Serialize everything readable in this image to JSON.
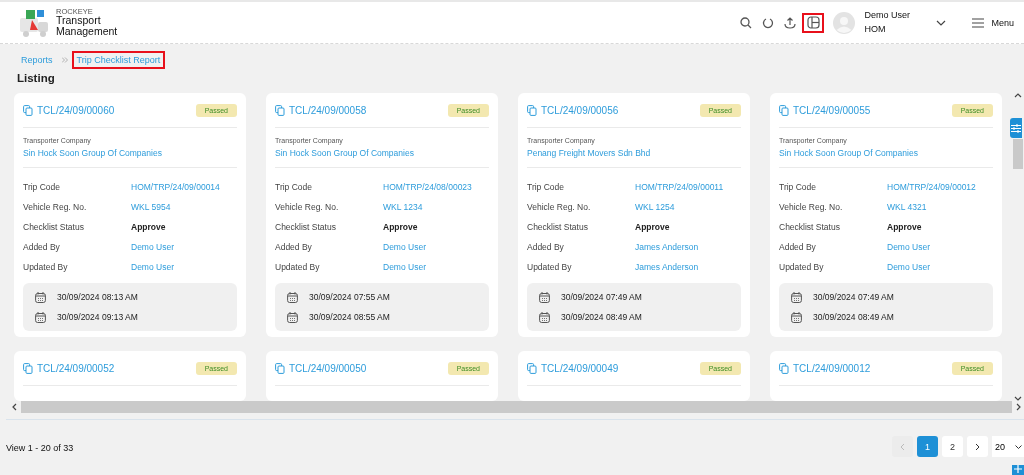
{
  "header": {
    "brand_small": "ROCKEYE",
    "brand_line_1": "Transport",
    "brand_line_2": "Management",
    "user_name": "Demo User",
    "user_org": "HOM",
    "menu_label": "Menu",
    "layout_icon_highlighted": true
  },
  "breadcrumb": [
    {
      "label": "Reports",
      "highlighted": false
    },
    {
      "label": "Trip Checklist Report",
      "highlighted": true
    }
  ],
  "page_title": "Listing",
  "cards": [
    {
      "code": "TCL/24/09/00060",
      "status": "Passed",
      "company_label": "Transporter Company",
      "company": "Sin Hock Soon Group Of Companies",
      "details": [
        {
          "label": "Trip Code",
          "value": "HOM/TRP/24/09/00014",
          "kind": "link"
        },
        {
          "label": "Vehicle Reg. No.",
          "value": "WKL 5954",
          "kind": "link"
        },
        {
          "label": "Checklist Status",
          "value": "Approve",
          "kind": "text"
        },
        {
          "label": "Added By",
          "value": "Demo User",
          "kind": "link"
        },
        {
          "label": "Updated By",
          "value": "Demo User",
          "kind": "link"
        }
      ],
      "dates": [
        "30/09/2024 08:13 AM",
        "30/09/2024 09:13 AM"
      ]
    },
    {
      "code": "TCL/24/09/00058",
      "status": "Passed",
      "company_label": "Transporter Company",
      "company": "Sin Hock Soon Group Of Companies",
      "details": [
        {
          "label": "Trip Code",
          "value": "HOM/TRP/24/08/00023",
          "kind": "link"
        },
        {
          "label": "Vehicle Reg. No.",
          "value": "WKL 1234",
          "kind": "link"
        },
        {
          "label": "Checklist Status",
          "value": "Approve",
          "kind": "text"
        },
        {
          "label": "Added By",
          "value": "Demo User",
          "kind": "link"
        },
        {
          "label": "Updated By",
          "value": "Demo User",
          "kind": "link"
        }
      ],
      "dates": [
        "30/09/2024 07:55 AM",
        "30/09/2024 08:55 AM"
      ]
    },
    {
      "code": "TCL/24/09/00056",
      "status": "Passed",
      "company_label": "Transporter Company",
      "company": "Penang Freight Movers Sdn Bhd",
      "details": [
        {
          "label": "Trip Code",
          "value": "HOM/TRP/24/09/00011",
          "kind": "link"
        },
        {
          "label": "Vehicle Reg. No.",
          "value": "WKL 1254",
          "kind": "link"
        },
        {
          "label": "Checklist Status",
          "value": "Approve",
          "kind": "text"
        },
        {
          "label": "Added By",
          "value": "James Anderson",
          "kind": "link"
        },
        {
          "label": "Updated By",
          "value": "James Anderson",
          "kind": "link"
        }
      ],
      "dates": [
        "30/09/2024 07:49 AM",
        "30/09/2024 08:49 AM"
      ]
    },
    {
      "code": "TCL/24/09/00055",
      "status": "Passed",
      "company_label": "Transporter Company",
      "company": "Sin Hock Soon Group Of Companies",
      "details": [
        {
          "label": "Trip Code",
          "value": "HOM/TRP/24/09/00012",
          "kind": "link"
        },
        {
          "label": "Vehicle Reg. No.",
          "value": "WKL 4321",
          "kind": "link"
        },
        {
          "label": "Checklist Status",
          "value": "Approve",
          "kind": "text"
        },
        {
          "label": "Added By",
          "value": "Demo User",
          "kind": "link"
        },
        {
          "label": "Updated By",
          "value": "Demo User",
          "kind": "link"
        }
      ],
      "dates": [
        "30/09/2024 07:49 AM",
        "30/09/2024 08:49 AM"
      ]
    },
    {
      "code": "TCL/24/09/00052",
      "status": "Passed"
    },
    {
      "code": "TCL/24/09/00050",
      "status": "Passed"
    },
    {
      "code": "TCL/24/09/00049",
      "status": "Passed"
    },
    {
      "code": "TCL/24/09/00012",
      "status": "Passed"
    }
  ],
  "footer": {
    "view_text": "View 1 - 20 of 33",
    "pages": [
      {
        "label": "1",
        "selected": true
      },
      {
        "label": "2",
        "selected": false
      }
    ],
    "prev_disabled": true,
    "next_disabled": false,
    "page_size": "20"
  }
}
